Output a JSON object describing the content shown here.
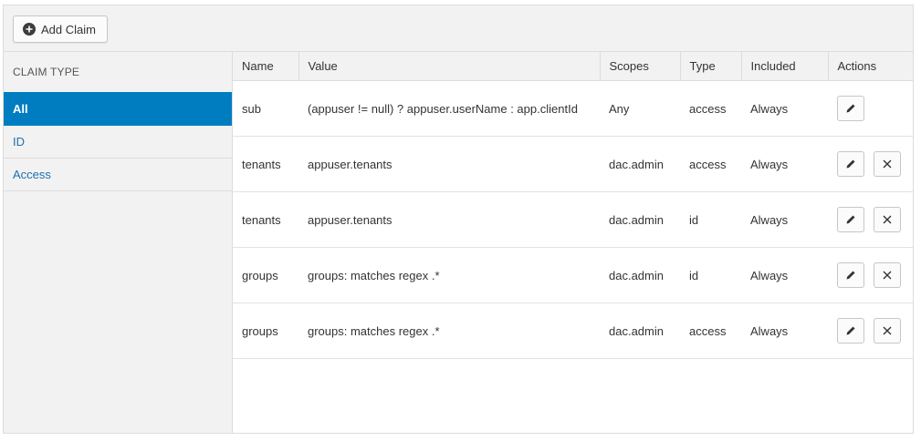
{
  "toolbar": {
    "add_claim_label": "Add Claim",
    "add_icon": "plus-circle-icon"
  },
  "sidebar": {
    "header": "CLAIM TYPE",
    "items": [
      {
        "label": "All",
        "active": true
      },
      {
        "label": "ID",
        "active": false
      },
      {
        "label": "Access",
        "active": false
      }
    ]
  },
  "table": {
    "columns": [
      "Name",
      "Value",
      "Scopes",
      "Type",
      "Included",
      "Actions"
    ],
    "rows": [
      {
        "name": "sub",
        "value": "(appuser != null) ? appuser.userName : app.clientId",
        "scopes": "Any",
        "type": "access",
        "included": "Always",
        "actions": [
          "edit"
        ]
      },
      {
        "name": "tenants",
        "value": "appuser.tenants",
        "scopes": "dac.admin",
        "type": "access",
        "included": "Always",
        "actions": [
          "edit",
          "delete"
        ]
      },
      {
        "name": "tenants",
        "value": "appuser.tenants",
        "scopes": "dac.admin",
        "type": "id",
        "included": "Always",
        "actions": [
          "edit",
          "delete"
        ]
      },
      {
        "name": "groups",
        "value": "groups: matches regex .*",
        "scopes": "dac.admin",
        "type": "id",
        "included": "Always",
        "actions": [
          "edit",
          "delete"
        ]
      },
      {
        "name": "groups",
        "value": "groups: matches regex .*",
        "scopes": "dac.admin",
        "type": "access",
        "included": "Always",
        "actions": [
          "edit",
          "delete"
        ]
      }
    ]
  },
  "colors": {
    "accent": "#007dc1",
    "link": "#1f6faf",
    "panel_bg": "#f2f2f2"
  }
}
